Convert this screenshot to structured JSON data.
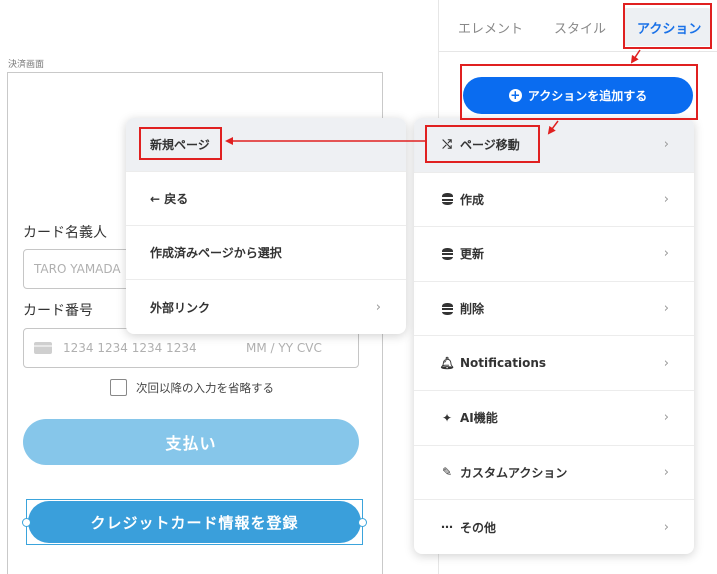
{
  "canvas": {
    "screen_label": "決済画面",
    "cardholder_label": "カード名義人",
    "cardholder_placeholder": "TARO YAMADA",
    "card_number_label": "カード番号",
    "card_number_placeholder": "1234 1234 1234 1234",
    "card_expiry_cvc_placeholder": "MM / YY  CVC",
    "skip_input_label": "次回以降の入力を省略する",
    "pay_button_label": "支払い",
    "register_button_label": "クレジットカード情報を登録"
  },
  "panel": {
    "tabs": [
      {
        "label": "エレメント",
        "active": false
      },
      {
        "label": "スタイル",
        "active": false
      },
      {
        "label": "アクション",
        "active": true
      }
    ],
    "add_action_label": "アクションを追加する"
  },
  "action_menu": {
    "items": [
      {
        "label": "ページ移動",
        "icon": "page-transition-icon",
        "chevron": "›"
      },
      {
        "label": "作成",
        "icon": "database-icon",
        "chevron": "›"
      },
      {
        "label": "更新",
        "icon": "database-icon",
        "chevron": "›"
      },
      {
        "label": "削除",
        "icon": "database-icon",
        "chevron": "›"
      },
      {
        "label": "Notifications",
        "icon": "bell-icon",
        "chevron": "›"
      },
      {
        "label": "AI機能",
        "icon": "sparkle-icon",
        "chevron": "›"
      },
      {
        "label": "カスタムアクション",
        "icon": "custom-action-icon",
        "chevron": "›"
      },
      {
        "label": "その他",
        "icon": "more-icon",
        "chevron": "›"
      }
    ]
  },
  "sub_menu": {
    "items": [
      {
        "label": "新規ページ"
      },
      {
        "label": "← 戻る"
      },
      {
        "label": "作成済みページから選択"
      },
      {
        "label": "外部リンク",
        "chevron": "›"
      }
    ]
  },
  "colors": {
    "accent": "#0a6cf0",
    "annotation_red": "#e02020",
    "register_button": "#3a9fdb",
    "pay_button_disabled": "#86c6ea"
  }
}
